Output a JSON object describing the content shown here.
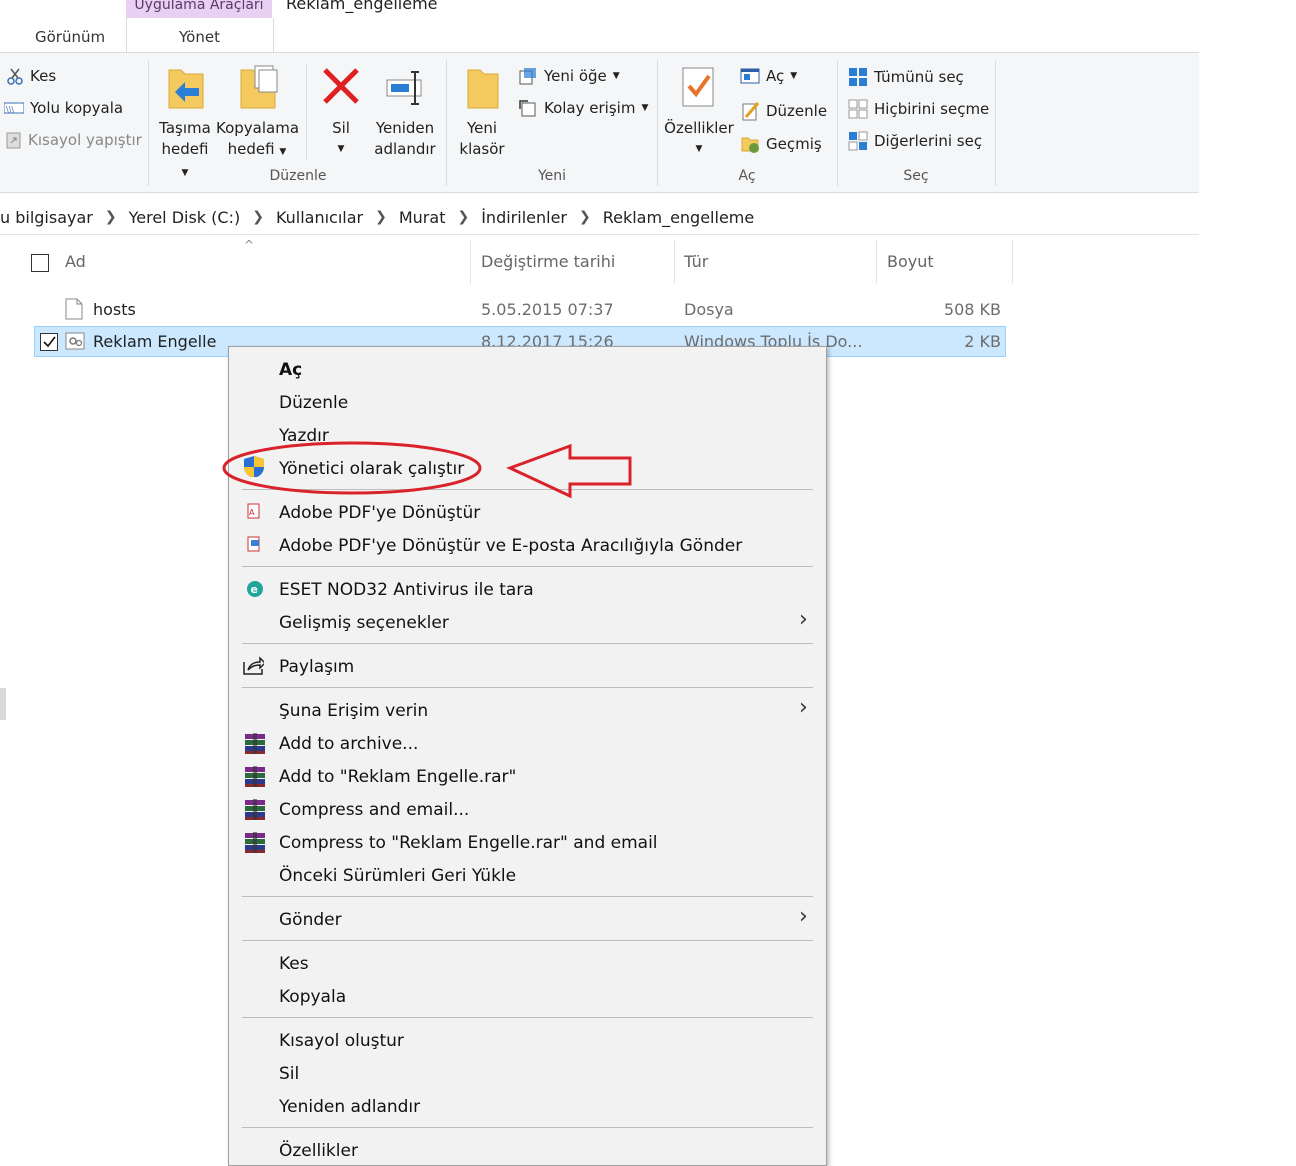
{
  "window": {
    "context_tab": "Uygulama Araçları",
    "title": "Reklam_engelleme",
    "tabs": [
      "Görünüm",
      "Yönet"
    ]
  },
  "ribbon": {
    "clipboard": {
      "cut": "Kes",
      "copy_path": "Yolu kopyala",
      "paste_shortcut": "Kısayol yapıştır"
    },
    "organize": {
      "move_to_1": "Taşıma",
      "move_to_2": "hedefi",
      "copy_to_1": "Kopyalama",
      "copy_to_2": "hedefi",
      "delete": "Sil",
      "rename_1": "Yeniden",
      "rename_2": "adlandır",
      "label": "Düzenle"
    },
    "new": {
      "new_folder_1": "Yeni",
      "new_folder_2": "klasör",
      "new_item": "Yeni öğe",
      "easy_access": "Kolay erişim",
      "label": "Yeni"
    },
    "open": {
      "properties": "Özellikler",
      "open": "Aç",
      "edit": "Düzenle",
      "history": "Geçmiş",
      "label": "Aç"
    },
    "select": {
      "select_all": "Tümünü seç",
      "select_none": "Hiçbirini seçme",
      "invert": "Diğerlerini seç",
      "label": "Seç"
    }
  },
  "breadcrumb": [
    "u bilgisayar",
    "Yerel Disk (C:)",
    "Kullanıcılar",
    "Murat",
    "İndirilenler",
    "Reklam_engelleme"
  ],
  "columns": {
    "name": "Ad",
    "date": "Değiştirme tarihi",
    "type": "Tür",
    "size": "Boyut"
  },
  "files": [
    {
      "name": "hosts",
      "date": "5.05.2015 07:37",
      "type": "Dosya",
      "size": "508 KB"
    },
    {
      "name": "Reklam Engelle",
      "date": "8.12.2017 15:26",
      "type": "Windows Toplu İş Do...",
      "size": "2 KB"
    }
  ],
  "context_menu": {
    "open": "Aç",
    "edit": "Düzenle",
    "print": "Yazdır",
    "run_as_admin": "Yönetici olarak çalıştır",
    "pdf_convert": "Adobe PDF'ye Dönüştür",
    "pdf_email": "Adobe PDF'ye Dönüştür ve E-posta Aracılığıyla Gönder",
    "eset": "ESET NOD32 Antivirus ile tara",
    "advanced": "Gelişmiş seçenekler",
    "share": "Paylaşım",
    "give_access": "Şuna Erişim verin",
    "add_archive": "Add to archive...",
    "add_rar": "Add to \"Reklam Engelle.rar\"",
    "compress_email": "Compress and email...",
    "compress_rar_email": "Compress to \"Reklam Engelle.rar\" and email",
    "restore": "Önceki Sürümleri Geri Yükle",
    "send_to": "Gönder",
    "cut": "Kes",
    "copy": "Kopyala",
    "create_shortcut": "Kısayol oluştur",
    "delete": "Sil",
    "rename": "Yeniden adlandır",
    "properties": "Özellikler"
  },
  "colors": {
    "selection": "#cce8ff",
    "annotation": "#d9222a",
    "context_tab": "#e7d0f2"
  }
}
